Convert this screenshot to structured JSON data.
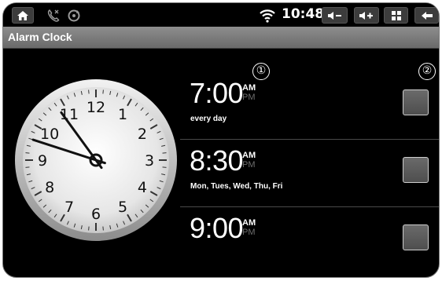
{
  "status_bar": {
    "time": "10:48",
    "icons": [
      "home-icon",
      "phone-icon",
      "sync-icon",
      "wifi-icon",
      "volume-down-icon",
      "volume-up-icon",
      "apps-icon",
      "back-icon"
    ]
  },
  "app": {
    "title": "Alarm Clock"
  },
  "clock": {
    "numbers": [
      "12",
      "1",
      "2",
      "3",
      "4",
      "5",
      "6",
      "7",
      "8",
      "9",
      "10",
      "11"
    ],
    "hour": 10,
    "minute": 48
  },
  "markers": [
    "①",
    "②"
  ],
  "alarms": [
    {
      "time": "7:00",
      "am": "AM",
      "pm": "PM",
      "days": "every day",
      "checked": false
    },
    {
      "time": "8:30",
      "am": "AM",
      "pm": "PM",
      "days": "Mon, Tues, Wed, Thu, Fri",
      "checked": false
    },
    {
      "time": "9:00",
      "am": "AM",
      "pm": "PM",
      "days": "",
      "checked": false
    }
  ]
}
